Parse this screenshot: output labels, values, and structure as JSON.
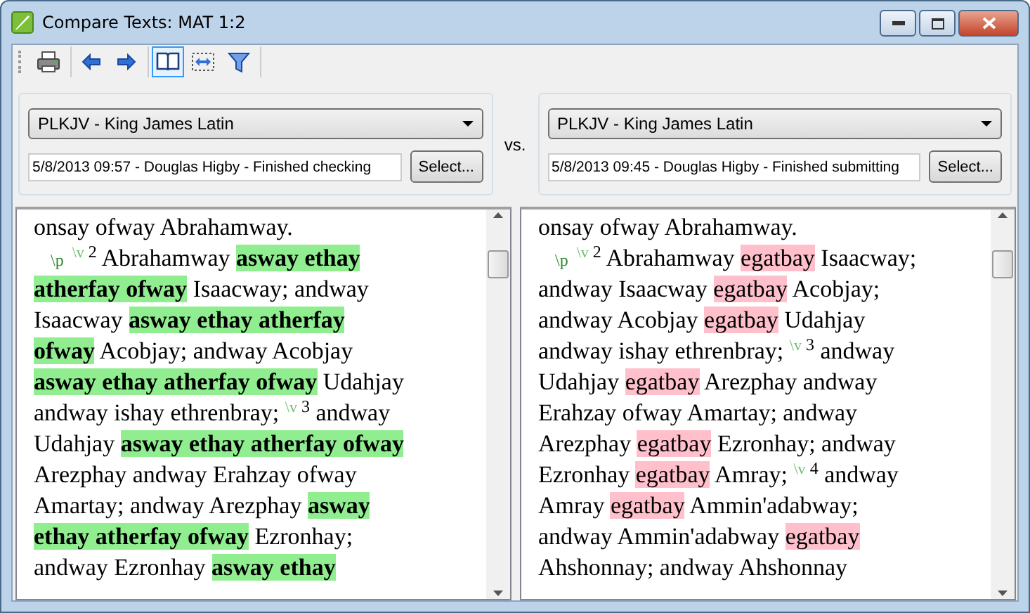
{
  "window": {
    "title": "Compare Texts: MAT 1:2"
  },
  "toolbar": [
    [
      {
        "kind": "print",
        "selected": false
      }
    ],
    [
      {
        "kind": "back",
        "selected": false
      },
      {
        "kind": "forward",
        "selected": false
      }
    ],
    [
      {
        "kind": "book",
        "selected": true
      },
      {
        "kind": "fit",
        "selected": false
      },
      {
        "kind": "filter",
        "selected": false
      }
    ]
  ],
  "versus": "vs.",
  "sources": [
    {
      "project": "PLKJV - King James Latin",
      "revision": "5/8/2013 09:57 - Douglas Higby - Finished checking",
      "button": "Select..."
    },
    {
      "project": "PLKJV - King James Latin",
      "revision": "5/8/2013 09:45 - Douglas Higby - Finished submitting",
      "button": "Select..."
    }
  ],
  "panes": [
    {
      "lines": [
        [
          {
            "kind": "text",
            "text": "onsay ofway Abrahamway."
          }
        ],
        [
          {
            "kind": "para",
            "text": "\\p"
          },
          {
            "kind": "verse",
            "text": "\\v",
            "number": "2"
          },
          {
            "kind": "text",
            "text": " Abrahamway "
          },
          {
            "kind": "added",
            "text": "asway ethay"
          }
        ],
        [
          {
            "kind": "added",
            "text": "atherfay ofway"
          },
          {
            "kind": "text",
            "text": " Isaacway; andway"
          }
        ],
        [
          {
            "kind": "text",
            "text": "Isaacway "
          },
          {
            "kind": "added",
            "text": "asway ethay atherfay"
          }
        ],
        [
          {
            "kind": "added",
            "text": "ofway"
          },
          {
            "kind": "text",
            "text": " Acobjay; andway Acobjay"
          }
        ],
        [
          {
            "kind": "added",
            "text": "asway ethay atherfay ofway"
          },
          {
            "kind": "text",
            "text": " Udahjay"
          }
        ],
        [
          {
            "kind": "text",
            "text": "andway ishay ethrenbray; "
          },
          {
            "kind": "verse",
            "text": "\\v",
            "number": "3"
          },
          {
            "kind": "text",
            "text": " andway"
          }
        ],
        [
          {
            "kind": "text",
            "text": "Udahjay "
          },
          {
            "kind": "added",
            "text": "asway ethay atherfay ofway"
          }
        ],
        [
          {
            "kind": "text",
            "text": "Arezphay andway Erahzay ofway"
          }
        ],
        [
          {
            "kind": "text",
            "text": "Amartay; andway Arezphay "
          },
          {
            "kind": "added",
            "text": "asway"
          }
        ],
        [
          {
            "kind": "added",
            "text": "ethay atherfay ofway"
          },
          {
            "kind": "text",
            "text": " Ezronhay;"
          }
        ],
        [
          {
            "kind": "text",
            "text": "andway Ezronhay "
          },
          {
            "kind": "added",
            "text": "asway ethay"
          }
        ]
      ]
    },
    {
      "lines": [
        [
          {
            "kind": "text",
            "text": "onsay ofway Abrahamway."
          }
        ],
        [
          {
            "kind": "para",
            "text": "\\p"
          },
          {
            "kind": "verse",
            "text": "\\v",
            "number": "2"
          },
          {
            "kind": "text",
            "text": " Abrahamway "
          },
          {
            "kind": "removed",
            "text": "egatbay"
          },
          {
            "kind": "text",
            "text": " Isaacway;"
          }
        ],
        [
          {
            "kind": "text",
            "text": "andway Isaacway "
          },
          {
            "kind": "removed",
            "text": "egatbay"
          },
          {
            "kind": "text",
            "text": " Acobjay;"
          }
        ],
        [
          {
            "kind": "text",
            "text": "andway Acobjay "
          },
          {
            "kind": "removed",
            "text": "egatbay"
          },
          {
            "kind": "text",
            "text": " Udahjay"
          }
        ],
        [
          {
            "kind": "text",
            "text": "andway ishay ethrenbray; "
          },
          {
            "kind": "verse",
            "text": "\\v",
            "number": "3"
          },
          {
            "kind": "text",
            "text": " andway"
          }
        ],
        [
          {
            "kind": "text",
            "text": "Udahjay "
          },
          {
            "kind": "removed",
            "text": "egatbay"
          },
          {
            "kind": "text",
            "text": " Arezphay andway"
          }
        ],
        [
          {
            "kind": "text",
            "text": "Erahzay ofway Amartay; andway"
          }
        ],
        [
          {
            "kind": "text",
            "text": "Arezphay "
          },
          {
            "kind": "removed",
            "text": "egatbay"
          },
          {
            "kind": "text",
            "text": " Ezronhay; andway"
          }
        ],
        [
          {
            "kind": "text",
            "text": "Ezronhay "
          },
          {
            "kind": "removed",
            "text": "egatbay"
          },
          {
            "kind": "text",
            "text": " Amray; "
          },
          {
            "kind": "verse",
            "text": "\\v",
            "number": "4"
          },
          {
            "kind": "text",
            "text": " andway"
          }
        ],
        [
          {
            "kind": "text",
            "text": "Amray "
          },
          {
            "kind": "removed",
            "text": "egatbay"
          },
          {
            "kind": "text",
            "text": " Ammin'adabway;"
          }
        ],
        [
          {
            "kind": "text",
            "text": "andway Ammin'adabway "
          },
          {
            "kind": "removed",
            "text": "egatbay"
          }
        ],
        [
          {
            "kind": "text",
            "text": "Ahshonnay; andway Ahshonnay"
          }
        ]
      ]
    }
  ]
}
